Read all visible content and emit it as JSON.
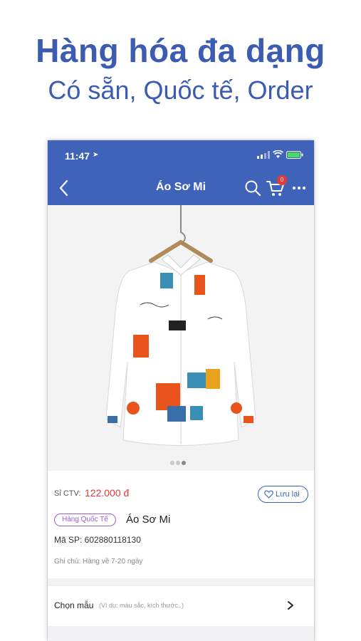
{
  "promo": {
    "headline": "Hàng hóa đa dạng",
    "subheadline": "Có sẵn, Quốc tế, Order"
  },
  "status_bar": {
    "time": "11:47"
  },
  "nav": {
    "title": "Áo Sơ Mi",
    "cart_count": "0"
  },
  "gallery": {
    "image_count": 3,
    "active_index": 2
  },
  "product": {
    "price_label": "Sỉ CTV:",
    "price": "122.000 đ",
    "save_label": "Lưu lại",
    "badge": "Hàng Quốc Tế",
    "name": "Áo Sơ Mi",
    "sku": "Mã SP: 602880118130",
    "note": "Ghi chú: Hàng về 7-20 ngày"
  },
  "options": {
    "label": "Chọn mẫu",
    "hint": "(Ví dụ: màu sắc, kích thước..)"
  },
  "colors": {
    "brand_blue": "#3e63b9",
    "headline_blue": "#3b5cb2",
    "price_red": "#e53935",
    "badge_purple": "#9c5fd4"
  }
}
